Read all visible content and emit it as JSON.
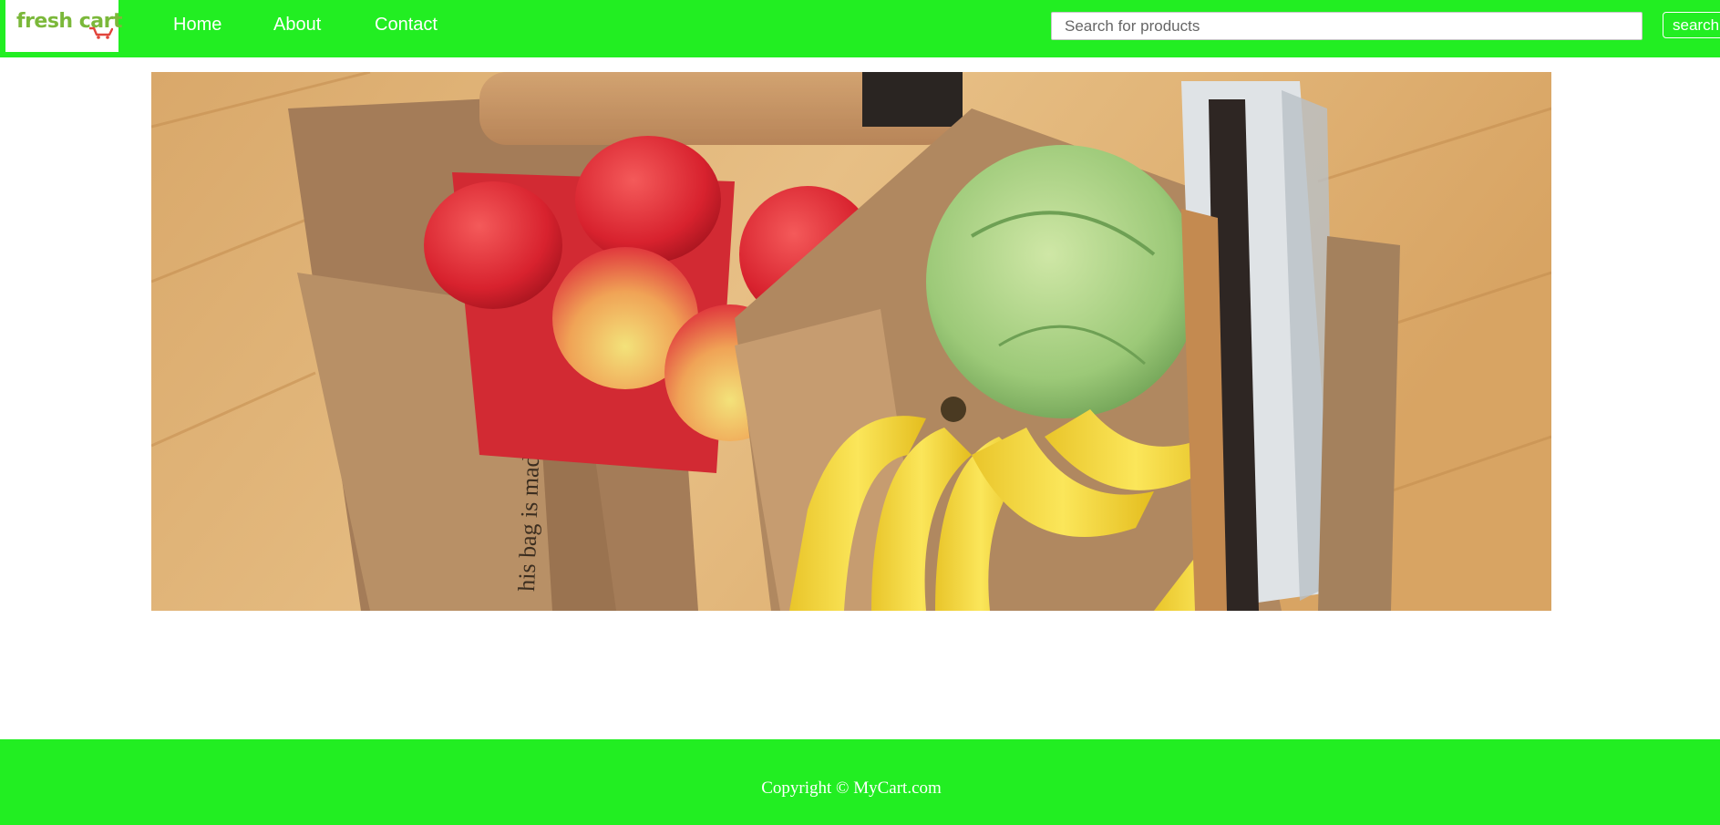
{
  "header": {
    "logo": {
      "text": "fresh cart",
      "icon": "cart-icon",
      "color": "#7bb83a",
      "cart_color": "#e2453c"
    },
    "nav": [
      {
        "label": "Home"
      },
      {
        "label": "About"
      },
      {
        "label": "Contact"
      }
    ],
    "search": {
      "placeholder": "Search for products",
      "value": "",
      "button_label": "search"
    },
    "background": "#22ee22"
  },
  "hero": {
    "image": "grocery-bags-photo",
    "description_icon": "groceries-image"
  },
  "footer": {
    "copyright": "Copyright © MyCart.com",
    "background": "#22ee22"
  }
}
